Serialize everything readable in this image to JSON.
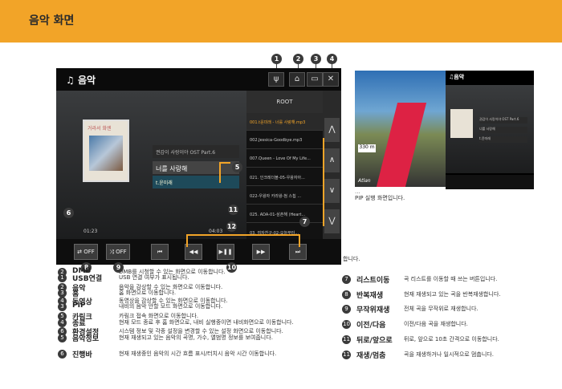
{
  "header": {
    "title": "음악 화면"
  },
  "screen": {
    "app_title": "음악",
    "album_header": "거라서 화엔",
    "track_info": [
      "권갑이 사랑이야 OST Part.6",
      "너를 사랑해",
      "t.윤미래"
    ],
    "time_current": "01:23",
    "time_total": "04:03",
    "progress_percent": 45,
    "playlist_header": "ROOT",
    "playlist": [
      "001.t윤미래 - 너를 사랑해.mp3",
      "002.Jessica-Goodbye.mp3",
      "007.Queen - Love Of My Life...",
      "021. 인크레더블-05-우왕자아...",
      "022-우왕자 카라왕-첨 스칩 ...",
      "025. ADA-01-삼촌해 (Heart..."
    ],
    "playlist_last": "03. 여자친구-02-오늘부터...",
    "repeat_label": "OFF",
    "shuffle_label": "OFF",
    "controls": [
      "⏮",
      "◀◀",
      "▶❚❚",
      "▶▶",
      "⏭"
    ]
  },
  "callouts": [
    "1",
    "2",
    "3",
    "4",
    "5",
    "6",
    "7",
    "8",
    "9",
    "10",
    "11",
    "12"
  ],
  "nav": {
    "speed": "330 m",
    "brand": "Atlan",
    "pip_title": "음악",
    "pip_rows": [
      "권갑이 사랑이야 OST Part.6",
      "너를 사랑해",
      "t.윤미래"
    ],
    "clipped_text": "...",
    "caption": "PIP 실행 화면입니다.",
    "side_tail": "합니다."
  },
  "descriptions_left": [
    {
      "num": "2",
      "term": "DMB",
      "text": "DMB를 시청할 수 있는 화면으로 이동합니다."
    },
    {
      "num": "1",
      "term": "USB연결",
      "text": "USB 연결 여부가 표시됩니다."
    },
    {
      "num": "2",
      "term": "음악",
      "text": "음악을 감상할 수 있는 화면으로 이동합니다."
    },
    {
      "num": "3",
      "term": "홈",
      "text": "홈 화면으로 이동합니다."
    },
    {
      "num": "4",
      "term": "동영상",
      "text": "동영상을 감상할 수 있는 화면으로 이동합니다."
    },
    {
      "num": "3",
      "term": "PIP",
      "text": "내비의 음악 안할 모드 화면으로 이동합니다."
    },
    {
      "num": "5",
      "term": "카림크",
      "text": "카림크 접속 화면으로 이동합니다."
    },
    {
      "num": "4",
      "term": "종료",
      "text": "현재 모드 종료 후 홈 화면으로, 내비 실행중이면 내비화면으로 이동합니다."
    },
    {
      "num": "6",
      "term": "환경설정",
      "text": "시스템 정보 및 각종 설정을 변경할 수 있는 설정 화면으로 이동합니다."
    },
    {
      "num": "5",
      "term": "음악정보",
      "text": "현재 재생되고 있는 음악의 곡명, 가수, 앨범명 정보를 보여줍니다."
    },
    {
      "num": "6",
      "term": "진행바",
      "text": "현재 재생중인 음악의 시간 흐름 표시/터치시 음악 시간 이동합니다."
    }
  ],
  "descriptions_right": [
    {
      "num": "7",
      "term": "리스트이동",
      "text": "곡 리스트를 이동할 때 쓰는 버튼입니다."
    },
    {
      "num": "8",
      "term": "반복재생",
      "text": "현재 재생되고 있는 곡을 반복재생합니다."
    },
    {
      "num": "9",
      "term": "무작위재생",
      "text": "전체 곡을 무작위로 재생합니다."
    },
    {
      "num": "10",
      "term": "이전/다음",
      "text": "이전/다음 곡을 재생합니다."
    },
    {
      "num": "11",
      "term": "뒤로/앞으로",
      "text": "뒤로, 앞으로 10초 간격으로 이동합니다."
    },
    {
      "num": "11",
      "term": "재생/멈춤",
      "text": "곡을 재생하거나 일시적으로 멈춥니다."
    }
  ]
}
